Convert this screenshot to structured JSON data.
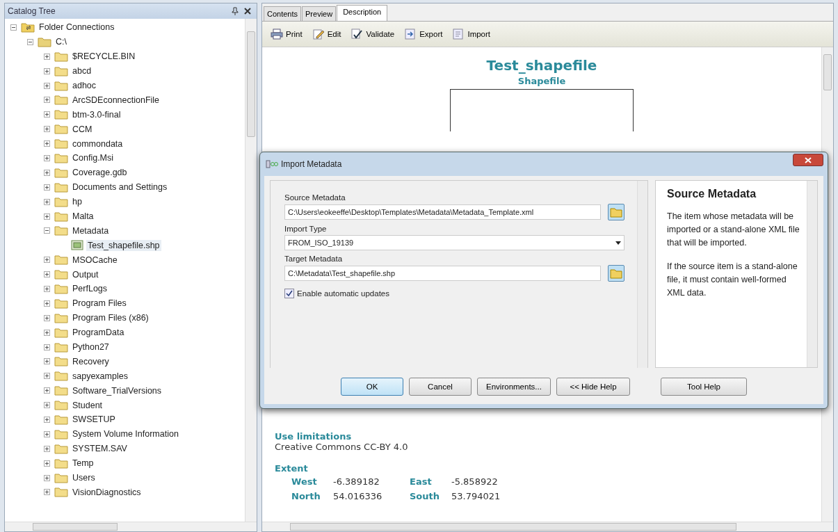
{
  "catalog_tree": {
    "title": "Catalog Tree",
    "items": [
      {
        "label": "Folder Connections",
        "kind": "connection",
        "expanded": true,
        "selected": false,
        "children": [
          {
            "label": "C:\\",
            "kind": "drive",
            "expanded": true,
            "selected": false,
            "children": [
              {
                "label": "$RECYCLE.BIN",
                "kind": "folder",
                "expanded": false,
                "selected": false
              },
              {
                "label": "abcd",
                "kind": "folder",
                "expanded": false,
                "selected": false
              },
              {
                "label": "adhoc",
                "kind": "folder",
                "expanded": false,
                "selected": false
              },
              {
                "label": "ArcSDEconnectionFile",
                "kind": "folder",
                "expanded": false,
                "selected": false
              },
              {
                "label": "btm-3.0-final",
                "kind": "folder",
                "expanded": false,
                "selected": false
              },
              {
                "label": "CCM",
                "kind": "folder",
                "expanded": false,
                "selected": false
              },
              {
                "label": "commondata",
                "kind": "folder",
                "expanded": false,
                "selected": false
              },
              {
                "label": "Config.Msi",
                "kind": "folder",
                "expanded": false,
                "selected": false
              },
              {
                "label": "Coverage.gdb",
                "kind": "folder",
                "expanded": false,
                "selected": false
              },
              {
                "label": "Documents and Settings",
                "kind": "folder",
                "expanded": false,
                "selected": false
              },
              {
                "label": "hp",
                "kind": "folder",
                "expanded": false,
                "selected": false
              },
              {
                "label": "Malta",
                "kind": "folder",
                "expanded": false,
                "selected": false
              },
              {
                "label": "Metadata",
                "kind": "folder",
                "expanded": true,
                "selected": false,
                "children": [
                  {
                    "label": "Test_shapefile.shp",
                    "kind": "shapefile",
                    "selected": true
                  }
                ]
              },
              {
                "label": "MSOCache",
                "kind": "folder",
                "expanded": false,
                "selected": false
              },
              {
                "label": "Output",
                "kind": "folder",
                "expanded": false,
                "selected": false
              },
              {
                "label": "PerfLogs",
                "kind": "folder",
                "expanded": false,
                "selected": false
              },
              {
                "label": "Program Files",
                "kind": "folder",
                "expanded": false,
                "selected": false
              },
              {
                "label": "Program Files (x86)",
                "kind": "folder",
                "expanded": false,
                "selected": false
              },
              {
                "label": "ProgramData",
                "kind": "folder",
                "expanded": false,
                "selected": false
              },
              {
                "label": "Python27",
                "kind": "folder",
                "expanded": false,
                "selected": false
              },
              {
                "label": "Recovery",
                "kind": "folder",
                "expanded": false,
                "selected": false
              },
              {
                "label": "sapyexamples",
                "kind": "folder",
                "expanded": false,
                "selected": false
              },
              {
                "label": "Software_TrialVersions",
                "kind": "folder",
                "expanded": false,
                "selected": false
              },
              {
                "label": "Student",
                "kind": "folder",
                "expanded": false,
                "selected": false
              },
              {
                "label": "SWSETUP",
                "kind": "folder",
                "expanded": false,
                "selected": false
              },
              {
                "label": "System Volume Information",
                "kind": "folder",
                "expanded": false,
                "selected": false
              },
              {
                "label": "SYSTEM.SAV",
                "kind": "folder",
                "expanded": false,
                "selected": false
              },
              {
                "label": "Temp",
                "kind": "folder",
                "expanded": false,
                "selected": false
              },
              {
                "label": "Users",
                "kind": "folder",
                "expanded": false,
                "selected": false
              },
              {
                "label": "VisionDiagnostics",
                "kind": "folder",
                "expanded": false,
                "selected": false
              }
            ]
          }
        ]
      }
    ]
  },
  "tabs": [
    {
      "label": "Contents",
      "selected": false
    },
    {
      "label": "Preview",
      "selected": false
    },
    {
      "label": "Description",
      "selected": true
    }
  ],
  "toolbar": [
    {
      "label": "Print",
      "kind": "print"
    },
    {
      "label": "Edit",
      "kind": "edit"
    },
    {
      "label": "Validate",
      "kind": "validate"
    },
    {
      "label": "Export",
      "kind": "export"
    },
    {
      "label": "Import",
      "kind": "import"
    }
  ],
  "description": {
    "title": "Test_shapefile",
    "subtitle": "Shapefile",
    "use_limitations": {
      "heading": "Use limitations",
      "text": "Creative Commons CC-BY 4.0"
    },
    "extent": {
      "heading": "Extent",
      "rows": [
        [
          {
            "label": "West",
            "value": "-6.389182"
          },
          {
            "label": "East",
            "value": "-5.858922"
          }
        ],
        [
          {
            "label": "North",
            "value": "54.016336"
          },
          {
            "label": "South",
            "value": "53.794021"
          }
        ]
      ]
    }
  },
  "dialog": {
    "title": "Import Metadata",
    "source": {
      "label": "Source Metadata",
      "value": "C:\\Users\\eokeeffe\\Desktop\\Templates\\Metadata\\Metadata_Template.xml"
    },
    "import_type": {
      "label": "Import Type",
      "value": "FROM_ISO_19139"
    },
    "target": {
      "label": "Target Metadata",
      "value": "C:\\Metadata\\Test_shapefile.shp"
    },
    "auto_update": {
      "label": "Enable automatic updates",
      "checked": true
    },
    "help": {
      "title": "Source Metadata",
      "paragraphs": [
        "The item whose metadata will be imported or a stand-alone XML file that will be imported.",
        "If the source item is a stand-alone file, it must contain well-formed XML data."
      ]
    },
    "buttons": [
      {
        "label": "OK",
        "default": true
      },
      {
        "label": "Cancel",
        "default": false
      },
      {
        "label": "Environments...",
        "default": false
      },
      {
        "label": "<< Hide Help",
        "default": false
      },
      {
        "label": "Tool Help",
        "default": false
      }
    ]
  }
}
